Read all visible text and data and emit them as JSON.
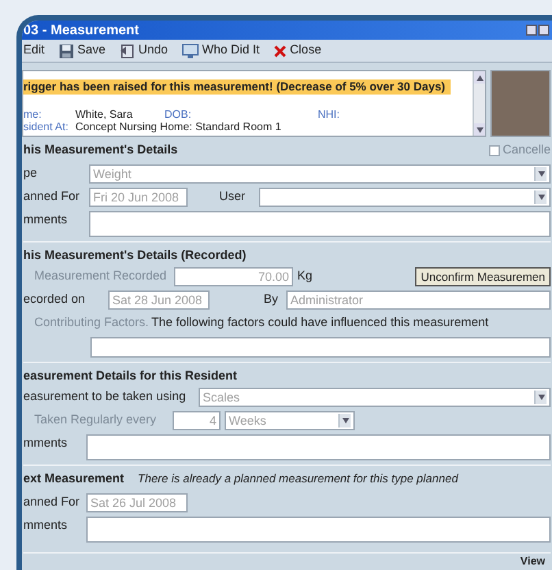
{
  "window": {
    "title": "03 - Measurement"
  },
  "toolbar": [
    {
      "label": "Edit",
      "kind": "plain"
    },
    {
      "label": "Save",
      "kind": "save"
    },
    {
      "label": "Undo",
      "kind": "undo"
    },
    {
      "label": "Who Did It",
      "kind": "audit"
    },
    {
      "label": "Close",
      "kind": "close"
    }
  ],
  "alert": "rigger has been raised for this measurement! (Decrease of 5% over 30 Days)",
  "resident": {
    "name_label": "me:",
    "name": "White, Sara",
    "dob_label": "DOB:",
    "nhi_label": "NHI:",
    "at_label": "sident At:",
    "at": "Concept Nursing Home: Standard Room 1"
  },
  "details": {
    "heading": "his Measurement's Details",
    "cancelled": {
      "label": "Cancelle",
      "checked": false
    },
    "type_label": "pe",
    "type": "Weight",
    "planned_label": "anned For",
    "planned": "Fri 20 Jun 2008",
    "user_label": "User",
    "comments_label": "mments"
  },
  "recorded": {
    "heading": "his Measurement's Details (Recorded)",
    "value_label": "Measurement Recorded",
    "value": "70.00",
    "unit": "Kg",
    "button": "Unconfirm Measuremen",
    "on_label": "ecorded on",
    "on": "Sat 28 Jun 2008",
    "by_label": "By",
    "by": "Administrator",
    "factors_label": "Contributing Factors.",
    "factors_note": "The following factors could have influenced this measurement"
  },
  "resident_details": {
    "heading": "easurement Details for this Resident",
    "using_label": "easurement to be taken using",
    "using": "Scales",
    "every_label": "Taken Regularly every",
    "every": "4",
    "period": "Weeks",
    "comments_label": "mments"
  },
  "next": {
    "heading": "ext Measurement",
    "note": "There is already a planned measurement for this type planned",
    "planned_label": "anned For",
    "planned": "Sat 26 Jul 2008",
    "comments_label": "mments"
  },
  "status_bar": "View"
}
